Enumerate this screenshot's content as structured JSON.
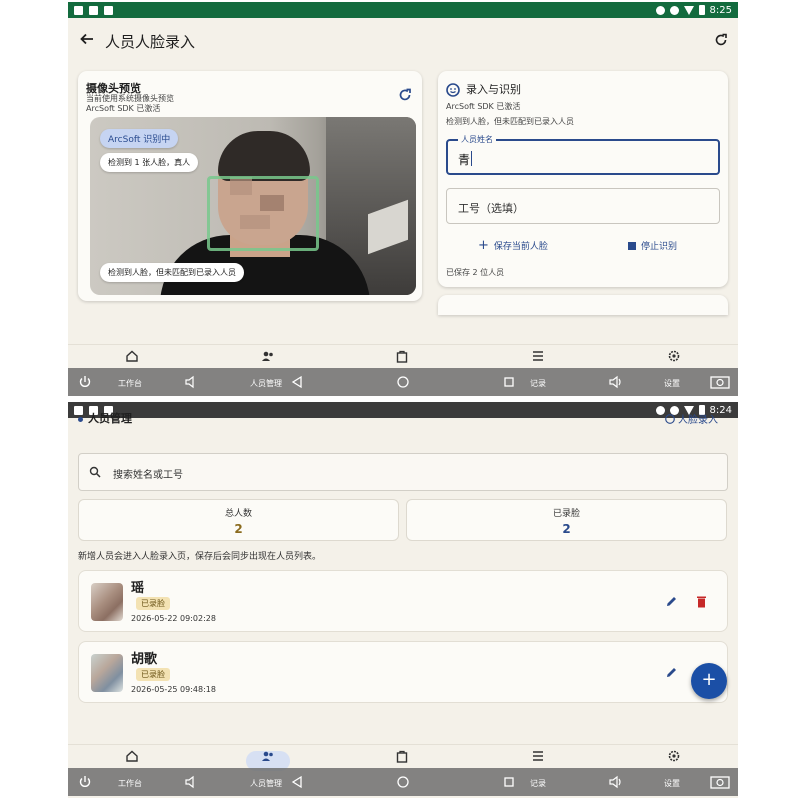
{
  "screen_a": {
    "status_time": "8:25",
    "title": "人员人脸录入",
    "camera_card": {
      "title": "摄像头预览",
      "subtitle1": "当前使用系统摄像头预览",
      "subtitle2": "ArcSoft SDK 已激活",
      "chip_status": "ArcSoft 识别中",
      "chip_face_count": "检测到 1 张人脸，真人",
      "chip_result": "检测到人脸，但未匹配到已录入人员"
    },
    "recognition_card": {
      "title": "录入与识别",
      "sdk_status": "ArcSoft SDK 已激活",
      "match_status": "检测到人脸，但未匹配到已录入人员",
      "name_label": "人员姓名",
      "name_value": "青",
      "id_placeholder": "工号（选填）",
      "save_button": "保存当前人脸",
      "stop_button": "停止识别",
      "saved_count": "已保存 2 位人员"
    }
  },
  "screen_b": {
    "status_time": "8:24",
    "header": "人员管理",
    "header_link": "人脸录入",
    "search_placeholder": "搜索姓名或工号",
    "stats": {
      "total_label": "总人数",
      "total_value": "2",
      "face_label": "已录脸",
      "face_value": "2"
    },
    "hint": "新增人员会进入人脸录入页，保存后会同步出现在人员列表。",
    "people": [
      {
        "name": "瑶",
        "badge": "已录脸",
        "time": "2026-05-22 09:02:28"
      },
      {
        "name": "胡歌",
        "badge": "已录脸",
        "time": "2026-05-25 09:48:18"
      }
    ],
    "fab": "+"
  },
  "nav": {
    "items": [
      "工作台",
      "人员管理",
      "",
      "记录",
      "设置"
    ]
  },
  "colors": {
    "accent": "#2a4a8c",
    "status_green": "#136b3e",
    "background": "#f4f1e9",
    "delete_red": "#c62828"
  }
}
